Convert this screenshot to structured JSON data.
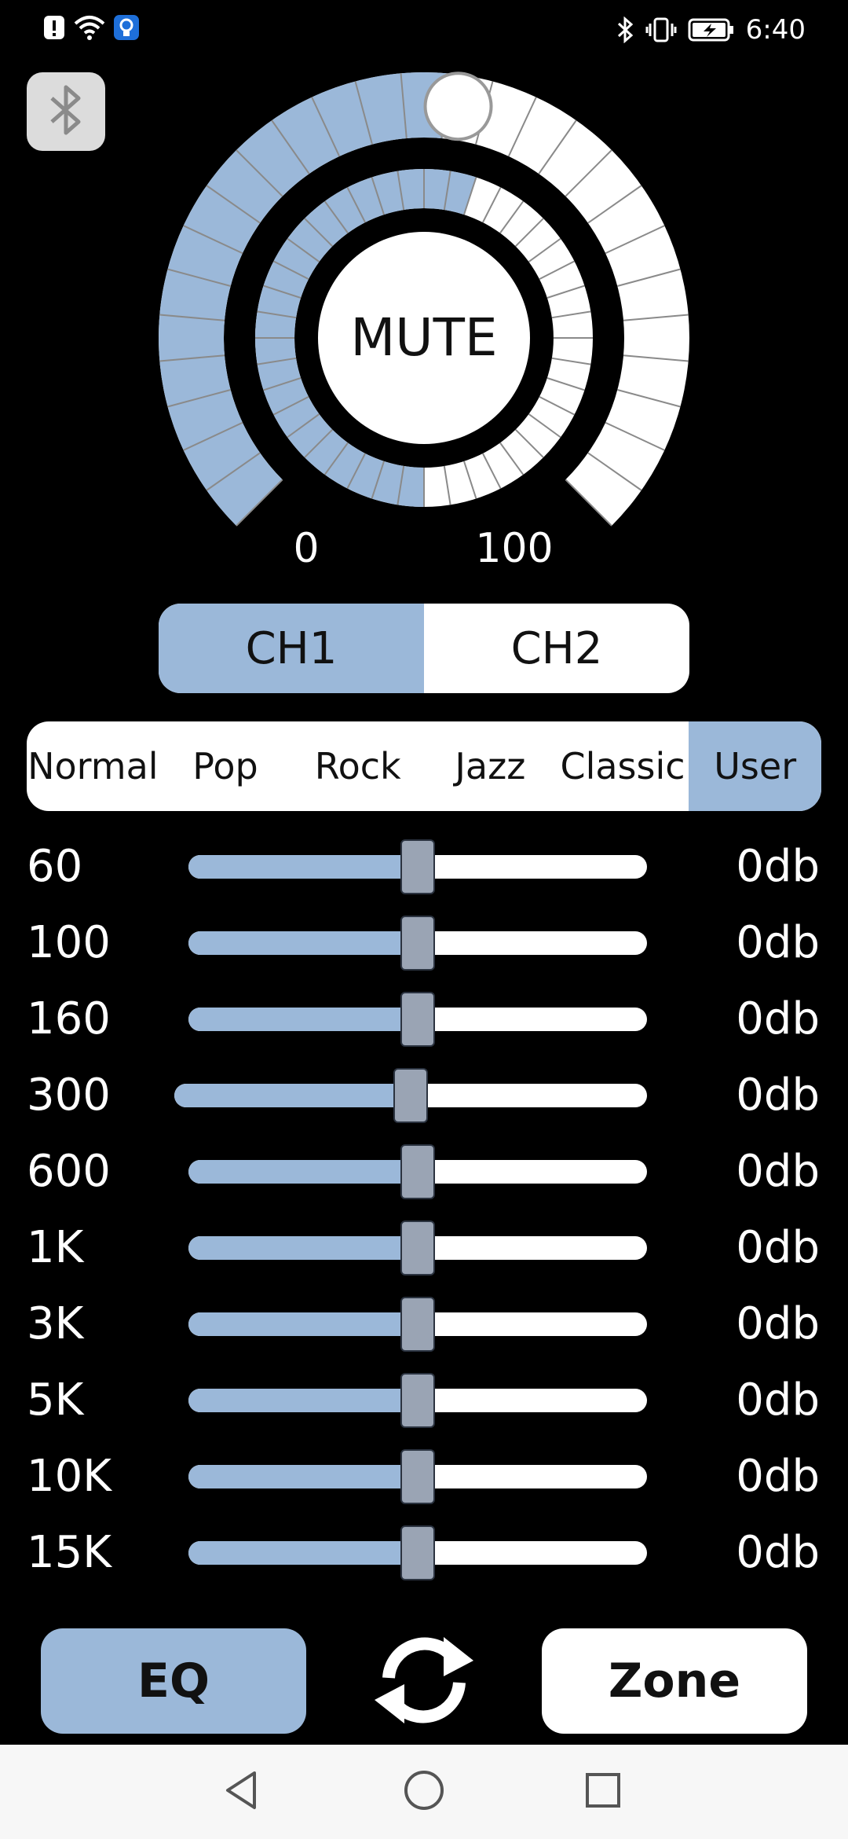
{
  "status_bar": {
    "time": "6:40",
    "left_icons": [
      "notification-alert-icon",
      "wifi-icon",
      "bulb-icon"
    ],
    "right_icons": [
      "bluetooth-icon",
      "vibrate-icon",
      "battery-charging-icon"
    ]
  },
  "bluetooth_button": {
    "icon": "bluetooth-icon"
  },
  "volume_dial": {
    "center_label": "MUTE",
    "scale_min_label": "0",
    "scale_max_label": "100",
    "outer_level_fraction": 0.52,
    "inner_level_fraction": 0.55,
    "accent_color": "#9bb8d9"
  },
  "channels": {
    "items": [
      {
        "label": "CH1",
        "active": true
      },
      {
        "label": "CH2",
        "active": false
      }
    ]
  },
  "presets": {
    "items": [
      {
        "label": "Normal",
        "active": false
      },
      {
        "label": "Pop",
        "active": false
      },
      {
        "label": "Rock",
        "active": false
      },
      {
        "label": "Jazz",
        "active": false
      },
      {
        "label": "Classic",
        "active": false
      },
      {
        "label": "User",
        "active": true
      }
    ]
  },
  "eq_bands": [
    {
      "label": "60",
      "value": "0db",
      "level_fraction": 0.5
    },
    {
      "label": "100",
      "value": "0db",
      "level_fraction": 0.5
    },
    {
      "label": "160",
      "value": "0db",
      "level_fraction": 0.5
    },
    {
      "label": "300",
      "value": "0db",
      "level_fraction": 0.5
    },
    {
      "label": "600",
      "value": "0db",
      "level_fraction": 0.5
    },
    {
      "label": "1K",
      "value": "0db",
      "level_fraction": 0.5
    },
    {
      "label": "3K",
      "value": "0db",
      "level_fraction": 0.5
    },
    {
      "label": "5K",
      "value": "0db",
      "level_fraction": 0.5
    },
    {
      "label": "10K",
      "value": "0db",
      "level_fraction": 0.5
    },
    {
      "label": "15K",
      "value": "0db",
      "level_fraction": 0.5
    }
  ],
  "bottom_bar": {
    "eq_label": "EQ",
    "zone_label": "Zone",
    "refresh_icon": "refresh-icon"
  },
  "nav_bar": {
    "icons": [
      "back-icon",
      "home-icon",
      "recents-icon"
    ]
  }
}
